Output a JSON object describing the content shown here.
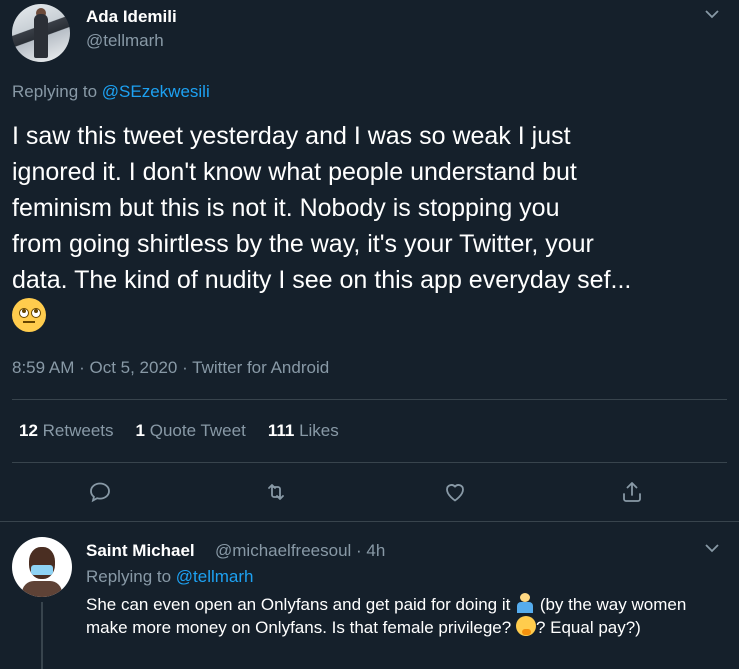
{
  "main_tweet": {
    "author_name": "Ada Idemili",
    "author_handle": "@tellmarh",
    "replying_prefix": "Replying to ",
    "replying_to": "@SEzekwesili",
    "text": "I saw this tweet yesterday and I was so weak I just\nignored it. I don't know what people understand but\nfeminism but this is not it. Nobody is stopping you\nfrom going shirtless by the way, it's your Twitter, your\ndata. The kind of nudity I see on this app everyday sef...",
    "emoji": "face-with-rolling-eyes",
    "timestamp": "8:59 AM · Oct 5, 2020 · Twitter for Android",
    "retweets_count": "12",
    "retweets_label": "Retweets",
    "quote_count": "1",
    "quote_label": "Quote Tweet",
    "likes_count": "111",
    "likes_label": "Likes"
  },
  "actions": {
    "icons": [
      "reply-icon",
      "retweet-icon",
      "like-icon",
      "share-icon"
    ]
  },
  "reply_tweet": {
    "author_name": "Saint Michael",
    "author_handle": "@michaelfreesoul · 4h",
    "replying_prefix": "Replying to ",
    "replying_to": "@tellmarh",
    "text_part1": "She can even open an Onlyfans and get paid for doing it ",
    "text_part2": " (by the way women make more money on Onlyfans. Is that female privilege? ",
    "text_part3": "? Equal pay?)",
    "emojis": [
      "person-shrugging",
      "thinking-face"
    ]
  },
  "colors": {
    "background": "#15202b",
    "text_primary": "#ffffff",
    "text_secondary": "#8899a6",
    "accent": "#1da1f2",
    "divider": "#38444d"
  }
}
